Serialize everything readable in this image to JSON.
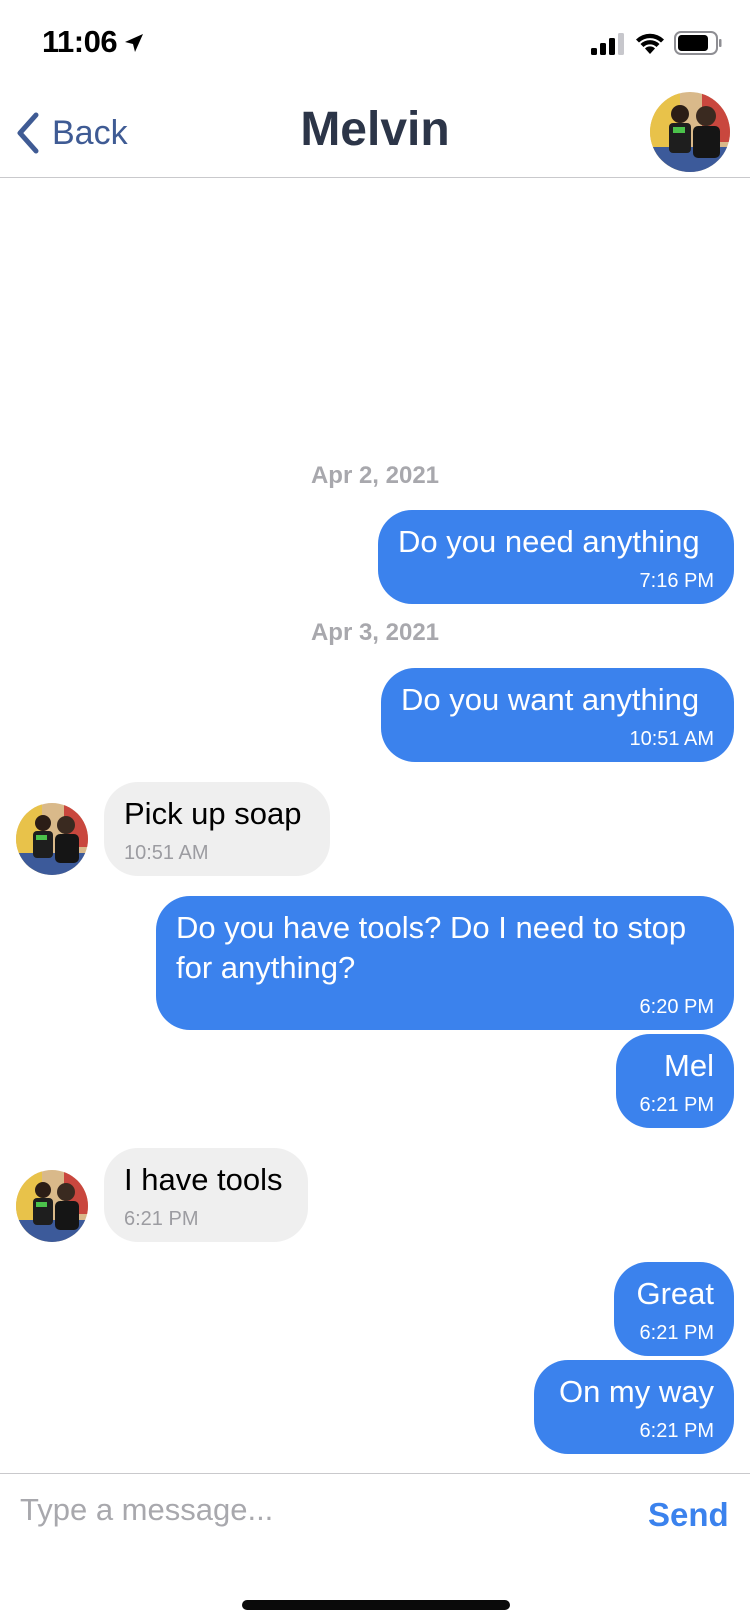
{
  "status_bar": {
    "time": "11:06",
    "icons": [
      "location-arrow-icon",
      "signal-icon",
      "wifi-icon",
      "battery-icon"
    ]
  },
  "nav": {
    "back_label": "Back",
    "title": "Melvin"
  },
  "dates": [
    "Apr 2, 2021",
    "Apr 3, 2021"
  ],
  "messages": [
    {
      "direction": "out",
      "text": "Do you need anything",
      "time": "7:16 PM"
    },
    {
      "direction": "out",
      "text": "Do you want anything",
      "time": "10:51 AM"
    },
    {
      "direction": "in",
      "text": "Pick up soap",
      "time": "10:51 AM"
    },
    {
      "direction": "out",
      "text": "Do you have tools? Do I need to stop for anything?",
      "time": "6:20 PM"
    },
    {
      "direction": "out",
      "text": "Mel",
      "time": "6:21 PM"
    },
    {
      "direction": "in",
      "text": "I have tools",
      "time": "6:21 PM"
    },
    {
      "direction": "out",
      "text": "Great",
      "time": "6:21 PM"
    },
    {
      "direction": "out",
      "text": "On my way",
      "time": "6:21 PM"
    }
  ],
  "composer": {
    "placeholder": "Type a message...",
    "send_label": "Send"
  },
  "colors": {
    "outgoing": "#3b82ed",
    "incoming": "#efefef",
    "nav_text": "#3f5b94",
    "title": "#2c3548"
  }
}
